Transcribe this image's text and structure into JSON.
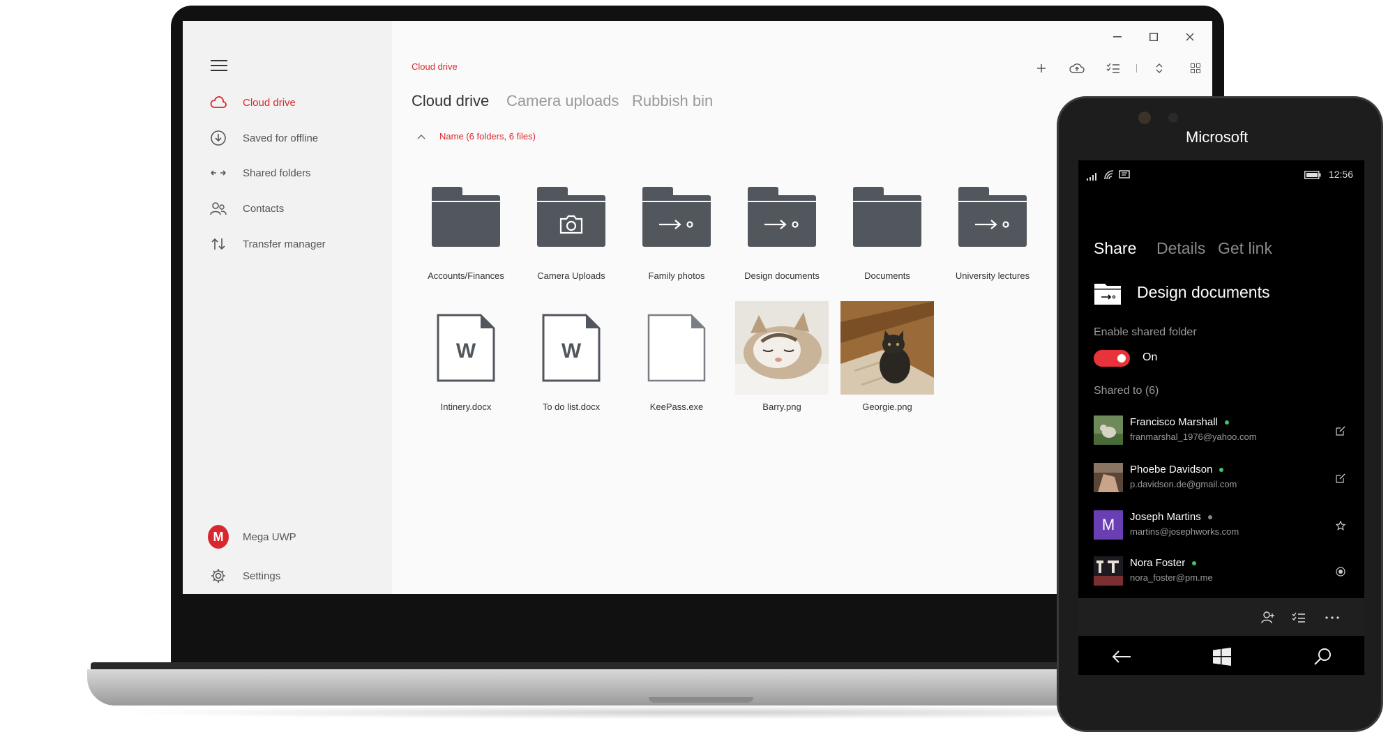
{
  "laptop": {
    "sidebar": {
      "items": [
        {
          "label": "Cloud drive",
          "icon": "cloud-icon",
          "active": true
        },
        {
          "label": "Saved for offline",
          "icon": "download-circle-icon"
        },
        {
          "label": "Shared folders",
          "icon": "arrows-left-right-icon"
        },
        {
          "label": "Contacts",
          "icon": "contacts-icon"
        },
        {
          "label": "Transfer manager",
          "icon": "transfer-icon"
        }
      ],
      "account": {
        "initial": "M",
        "label": "Mega UWP"
      },
      "settings_label": "Settings"
    },
    "breadcrumb": "Cloud drive",
    "tabs": [
      {
        "label": "Cloud drive",
        "active": true
      },
      {
        "label": "Camera uploads"
      },
      {
        "label": "Rubbish bin"
      }
    ],
    "sort_label": "Name (6 folders, 6 files)",
    "folders": [
      {
        "label": "Accounts/Finances",
        "type": "plain"
      },
      {
        "label": "Camera Uploads",
        "type": "camera"
      },
      {
        "label": "Family photos",
        "type": "shared"
      },
      {
        "label": "Design documents",
        "type": "shared"
      },
      {
        "label": "Documents",
        "type": "plain"
      },
      {
        "label": "University lectures",
        "type": "shared"
      }
    ],
    "files": [
      {
        "label": "Intinery.docx",
        "type": "word",
        "glyph": "W"
      },
      {
        "label": "To do list.docx",
        "type": "word",
        "glyph": "W"
      },
      {
        "label": "KeePass.exe",
        "type": "blank"
      },
      {
        "label": "Barry.png",
        "type": "photo-cat1"
      },
      {
        "label": "Georgie.png",
        "type": "photo-cat2"
      }
    ]
  },
  "phone": {
    "brand": "Microsoft",
    "time": "12:56",
    "tabs": [
      {
        "label": "Share",
        "active": true
      },
      {
        "label": "Details"
      },
      {
        "label": "Get link"
      }
    ],
    "folder_title": "Design documents",
    "enable_label": "Enable shared folder",
    "toggle_label": "On",
    "shared_to_label": "Shared to (6)",
    "contacts": [
      {
        "name": "Francisco Marshall",
        "email": "franmarshal_1976@yahoo.com",
        "status": "online",
        "action": "edit-icon"
      },
      {
        "name": "Phoebe Davidson",
        "email": "p.davidson.de@gmail.com",
        "status": "online",
        "action": "edit-icon"
      },
      {
        "name": "Joseph Martins",
        "email": "martins@josephworks.com",
        "status": "away",
        "action": "star-icon",
        "initial": "M"
      },
      {
        "name": "Nora Foster",
        "email": "nora_foster@pm.me",
        "status": "online",
        "action": "radio-icon"
      }
    ],
    "colors": {
      "accent": "#d9272e",
      "toggle": "#e8333a",
      "online": "#3fc46a",
      "avatar_purple": "#6b3fb4"
    }
  }
}
